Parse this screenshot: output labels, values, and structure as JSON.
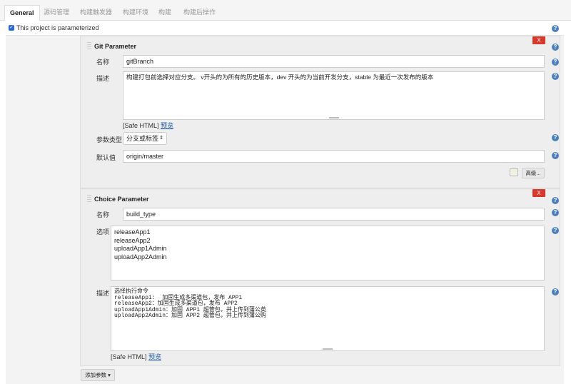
{
  "tabs": [
    "General",
    "源码管理",
    "构建触发器",
    "构建环境",
    "构建",
    "构建后操作"
  ],
  "parameterized_label": "This project is parameterized",
  "git_param": {
    "title": "Git Parameter",
    "close": "X",
    "name_label": "名称",
    "name_value": "gitBranch",
    "desc_label": "描述",
    "desc_value": "构建打包前选择对应分支。 v开头的为所有的历史版本，dev 开头的为当前开发分支，stable 为最近一次发布的版本",
    "safe_html": "[Safe HTML]",
    "preview": "预览",
    "type_label": "参数类型",
    "type_value": "分支或标签",
    "default_label": "默认值",
    "default_value": "origin/master",
    "advanced": "高级..."
  },
  "choice_param": {
    "title": "Choice Parameter",
    "close": "X",
    "name_label": "名称",
    "name_value": "build_type",
    "choices_label": "选项",
    "choices_value": "releaseApp1\nreleaseApp2\nuploadApp1Admin\nuploadApp2Admin",
    "desc_label": "描述",
    "desc_value": "选择执行命令\nreleaseApp1:  加固生成多渠道包，发布 APP1\nreleaseApp2：加固生成多渠道包，发布 APP2\nuploadApp1Admin：加固 APP1 超管包，并上传到蒲公英\nuploadApp2Admin：加固 APP2 超管包，并上传到蒲公购",
    "safe_html": "[Safe HTML]",
    "preview": "预览"
  },
  "add_param": "添加参数 ▾",
  "help": "?"
}
